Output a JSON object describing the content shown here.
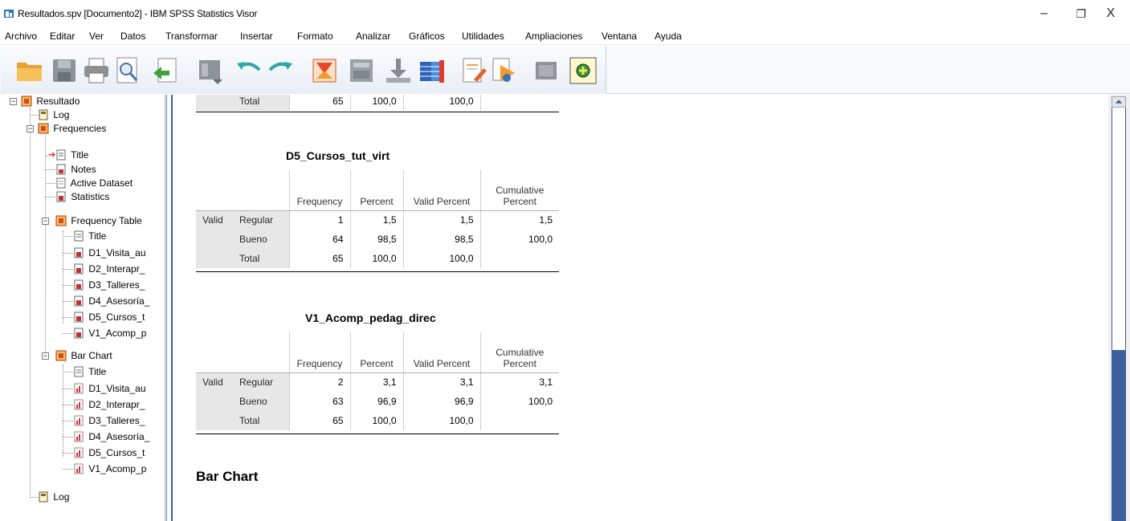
{
  "window": {
    "title": "Resultados.spv [Documento2] - IBM SPSS Statistics Visor",
    "controls": {
      "minimize": "–",
      "maximize": "❐",
      "close": "X"
    }
  },
  "menu": [
    "Archivo",
    "Editar",
    "Ver",
    "Datos",
    "Transformar",
    "Insertar",
    "Formato",
    "Analizar",
    "Gráficos",
    "Utilidades",
    "Ampliaciones",
    "Ventana",
    "Ayuda"
  ],
  "toolbar": {
    "icons": [
      "open-folder-icon",
      "save-icon",
      "print-icon",
      "print-preview-icon",
      "export-icon",
      "recall-dialog-icon",
      "undo-icon",
      "redo-icon",
      "goto-data-icon",
      "goto-case-icon",
      "goto-variable-icon",
      "variables-icon",
      "create-title-icon",
      "insert-output-icon",
      "hide-icon",
      "designate-window-icon"
    ]
  },
  "outline": {
    "root": "Resultado",
    "log1": "Log",
    "frequencies": "Frequencies",
    "title": "Title",
    "notes": "Notes",
    "active_dataset": "Active Dataset",
    "statistics": "Statistics",
    "frequency_table": "Frequency Table",
    "ft_title": "Title",
    "ft_items": [
      "D1_Visita_au",
      "D2_Interapr_",
      "D3_Talleres_",
      "D4_Asesoría_",
      "D5_Cursos_t",
      "V1_Acomp_p"
    ],
    "bar_chart": "Bar Chart",
    "bc_title": "Title",
    "bc_items": [
      "D1_Visita_au",
      "D2_Interapr_",
      "D3_Talleres_",
      "D4_Asesoría_",
      "D5_Cursos_t",
      "V1_Acomp_p"
    ],
    "log2": "Log"
  },
  "content": {
    "top_total": {
      "label": "Total",
      "frequency": "65",
      "percent": "100,0",
      "valid_percent": "100,0"
    },
    "headers": {
      "frequency": "Frequency",
      "percent": "Percent",
      "valid_percent": "Valid Percent",
      "cumulative_1": "Cumulative",
      "cumulative_2": "Percent"
    },
    "table_d5": {
      "title": "D5_Cursos_tut_virt",
      "group": "Valid",
      "rows": [
        {
          "label": "Regular",
          "frequency": "1",
          "percent": "1,5",
          "valid_percent": "1,5",
          "cumulative": "1,5"
        },
        {
          "label": "Bueno",
          "frequency": "64",
          "percent": "98,5",
          "valid_percent": "98,5",
          "cumulative": "100,0"
        },
        {
          "label": "Total",
          "frequency": "65",
          "percent": "100,0",
          "valid_percent": "100,0",
          "cumulative": ""
        }
      ]
    },
    "table_v1": {
      "title": "V1_Acomp_pedag_direc",
      "group": "Valid",
      "rows": [
        {
          "label": "Regular",
          "frequency": "2",
          "percent": "3,1",
          "valid_percent": "3,1",
          "cumulative": "3,1"
        },
        {
          "label": "Bueno",
          "frequency": "63",
          "percent": "96,9",
          "valid_percent": "96,9",
          "cumulative": "100,0"
        },
        {
          "label": "Total",
          "frequency": "65",
          "percent": "100,0",
          "valid_percent": "100,0",
          "cumulative": ""
        }
      ]
    },
    "bar_chart_heading": "Bar Chart"
  },
  "colors": {
    "stub_gray": "#e7e7e7",
    "scroll_blue": "#3d5f9d",
    "accent_orange": "#e9a133"
  }
}
